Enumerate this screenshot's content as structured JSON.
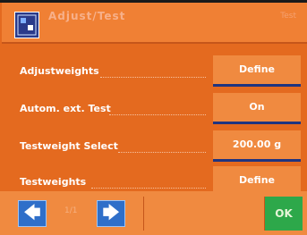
{
  "titlebar": {
    "title": "Adjust/Test",
    "right_text": "Test"
  },
  "rows": [
    {
      "label": "Adjustweights",
      "value": "Define"
    },
    {
      "label": "Autom. ext. Test",
      "value": "On"
    },
    {
      "label": "Testweight Select",
      "value": "200.00 g"
    },
    {
      "label": "Testweights",
      "value": "Define"
    }
  ],
  "bottom": {
    "prev_label": "🡄",
    "next_label": "🡆",
    "page_indicator": "1/1",
    "ok_label": "OK"
  },
  "colors": {
    "background": "#e46a1f",
    "button": "#f08a40",
    "button_underline": "#1f3480",
    "ok": "#2da84a",
    "nav": "#2f6fc9"
  },
  "icons": {
    "title_icon": "settings-screen-icon",
    "prev_icon": "arrow-left-icon",
    "next_icon": "arrow-right-icon"
  }
}
